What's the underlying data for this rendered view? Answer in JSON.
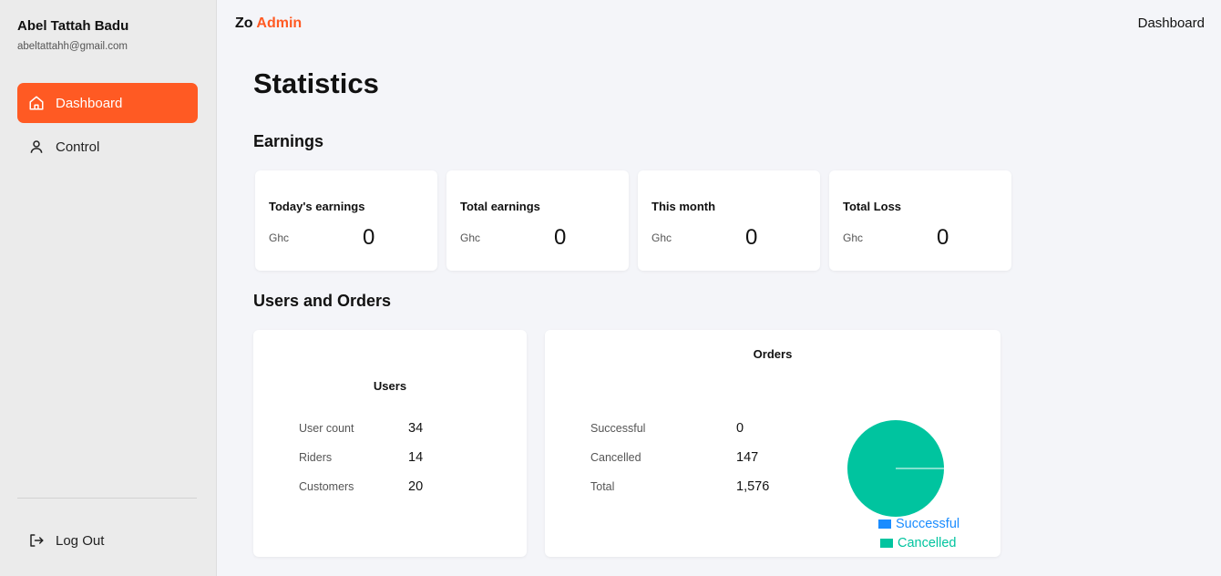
{
  "user": {
    "name": "Abel Tattah Badu",
    "email": "abeltattahh@gmail.com"
  },
  "sidebar": {
    "items": [
      {
        "label": "Dashboard",
        "icon": "home-icon",
        "active": true
      },
      {
        "label": "Control",
        "icon": "user-icon",
        "active": false
      }
    ],
    "logout": {
      "label": "Log Out",
      "icon": "logout-icon"
    }
  },
  "header": {
    "brand_prefix": "Zo",
    "brand_suffix": "Admin",
    "nav_link": "Dashboard"
  },
  "page": {
    "title": "Statistics"
  },
  "earnings": {
    "title": "Earnings",
    "cards": [
      {
        "label": "Today's earnings",
        "currency": "Ghc",
        "value": "0"
      },
      {
        "label": "Total earnings",
        "currency": "Ghc",
        "value": "0"
      },
      {
        "label": "This month",
        "currency": "Ghc",
        "value": "0"
      },
      {
        "label": "Total Loss",
        "currency": "Ghc",
        "value": "0"
      }
    ]
  },
  "users_orders": {
    "title": "Users and Orders",
    "users": {
      "title": "Users",
      "rows": [
        {
          "label": "User count",
          "value": "34"
        },
        {
          "label": "Riders",
          "value": "14"
        },
        {
          "label": "Customers",
          "value": "20"
        }
      ]
    },
    "orders": {
      "title": "Orders",
      "rows": [
        {
          "label": "Successful",
          "value": "0"
        },
        {
          "label": "Cancelled",
          "value": "147"
        },
        {
          "label": "Total",
          "value": "1,576"
        }
      ]
    }
  },
  "chart_data": {
    "type": "pie",
    "categories": [
      "Successful",
      "Cancelled"
    ],
    "values": [
      0,
      147
    ],
    "colors": [
      "#1a8cff",
      "#00c49f"
    ],
    "legend": "bottom-right"
  },
  "colors": {
    "accent": "#ff5a23",
    "sidebar_bg": "#ebebeb",
    "page_bg": "#f4f5f9"
  }
}
